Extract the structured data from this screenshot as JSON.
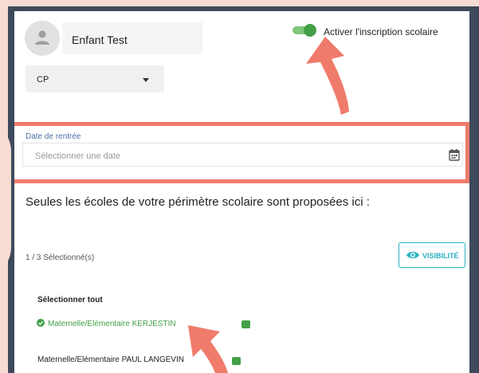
{
  "child": {
    "name": "Enfant Test"
  },
  "toggle": {
    "label": "Activer l'inscription scolaire",
    "on": true
  },
  "grade": {
    "value": "CP"
  },
  "date": {
    "label": "Date de rentrée",
    "placeholder": "Sélectionner une date"
  },
  "intro": "Seules les écoles de votre périmètre scolaire sont proposées ici :",
  "selection": {
    "count_label": "1 / 3 Sélectionné(s)",
    "visibility_label": "VISIBILITÉ"
  },
  "schools": {
    "select_all": "Sélectionner tout",
    "items": [
      {
        "label": "Maternelle/Elémentaire KERJESTIN",
        "selected": true
      },
      {
        "label": "Maternelle/Elémentaire PAUL LANGEVIN",
        "selected": false
      }
    ]
  },
  "colors": {
    "accent_green": "#43a047",
    "highlight": "#ef7b6b",
    "visibility_teal": "#2bb3c0",
    "frame": "#3e4a5c"
  }
}
